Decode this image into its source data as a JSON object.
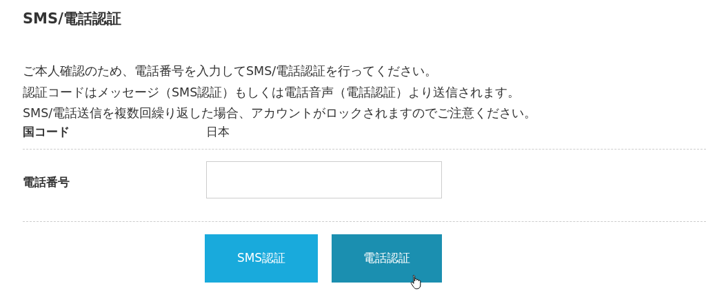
{
  "title": "SMS/電話認証",
  "description": [
    "ご本人確認のため、電話番号を入力してSMS/電話認証を行ってください。",
    "認証コードはメッセージ（SMS認証）もしくは電話音声（電話認証）より送信されます。",
    "SMS/電話送信を複数回繰り返した場合、アカウントがロックされますのでご注意ください。"
  ],
  "country": {
    "label": "国コード",
    "value": "日本"
  },
  "phone": {
    "label": "電話番号"
  },
  "buttons": [
    {
      "label": "SMS認証",
      "hovered": false
    },
    {
      "label": "電話認証",
      "hovered": true
    }
  ]
}
